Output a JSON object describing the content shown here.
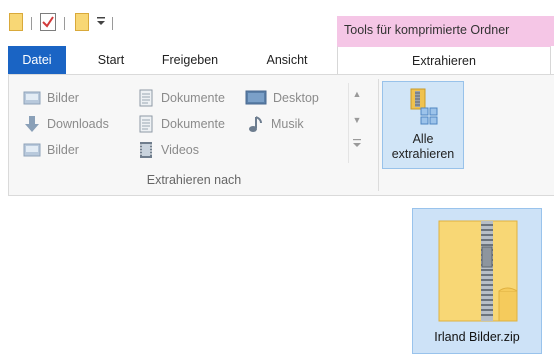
{
  "quick_access": {
    "icons": [
      "folder-icon",
      "checkmark-document-icon",
      "new-folder-icon",
      "customize-dropdown-icon"
    ]
  },
  "context_tab": {
    "title": "Tools für komprimierte Ordner"
  },
  "tabs": [
    {
      "label": "Datei"
    },
    {
      "label": "Start"
    },
    {
      "label": "Freigeben"
    },
    {
      "label": "Ansicht"
    },
    {
      "label": "Extrahieren"
    }
  ],
  "ribbon": {
    "destinations": [
      {
        "label": "Bilder",
        "icon": "pictures-icon"
      },
      {
        "label": "Downloads",
        "icon": "download-arrow-icon"
      },
      {
        "label": "Bilder",
        "icon": "pictures-icon"
      },
      {
        "label": "Dokumente",
        "icon": "document-icon"
      },
      {
        "label": "Dokumente",
        "icon": "document-icon"
      },
      {
        "label": "Videos",
        "icon": "video-icon"
      },
      {
        "label": "Desktop",
        "icon": "desktop-icon"
      },
      {
        "label": "Musik",
        "icon": "music-note-icon"
      }
    ],
    "group_label": "Extrahieren nach",
    "extract_all": {
      "line1": "Alle",
      "line2": "extrahieren"
    }
  },
  "content": {
    "file": {
      "name": "Irland Bilder.zip",
      "icon": "zip-folder-icon"
    }
  }
}
